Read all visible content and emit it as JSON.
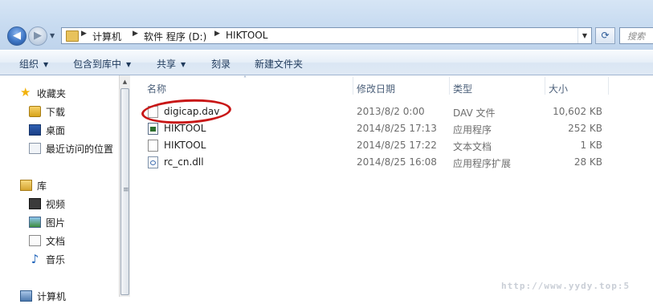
{
  "address": {
    "crumbs": [
      "计算机",
      "软件 程序 (D:)",
      "HIKTOOL"
    ],
    "search_placeholder": "搜索"
  },
  "toolbar": {
    "organize": "组织",
    "include_in_library": "包含到库中",
    "share": "共享",
    "burn": "刻录",
    "new_folder": "新建文件夹"
  },
  "navpane": {
    "favorites": "收藏夹",
    "downloads": "下载",
    "desktop": "桌面",
    "recent_places": "最近访问的位置",
    "libraries": "库",
    "videos": "视频",
    "pictures": "图片",
    "documents": "文档",
    "music": "音乐",
    "computer": "计算机"
  },
  "columns": {
    "name": "名称",
    "date_modified": "修改日期",
    "type": "类型",
    "size": "大小"
  },
  "files": [
    {
      "name": "digicap.dav",
      "date": "2013/8/2 0:00",
      "type": "DAV 文件",
      "size": "10,602 KB"
    },
    {
      "name": "HIKTOOL",
      "date": "2014/8/25 17:13",
      "type": "应用程序",
      "size": "252 KB"
    },
    {
      "name": "HIKTOOL",
      "date": "2014/8/25 17:22",
      "type": "文本文档",
      "size": "1 KB"
    },
    {
      "name": "rc_cn.dll",
      "date": "2014/8/25 16:08",
      "type": "应用程序扩展",
      "size": "28 KB"
    }
  ],
  "watermark": "http://www.yydy.top:5"
}
